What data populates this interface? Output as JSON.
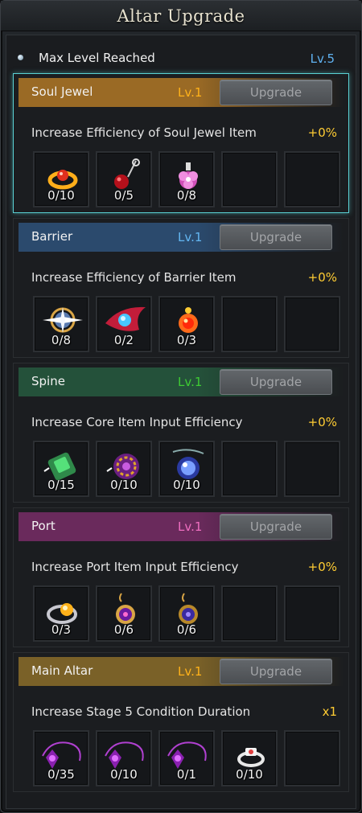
{
  "window": {
    "title": "Altar Upgrade"
  },
  "status": {
    "text": "Max Level Reached",
    "level": "Lv.5"
  },
  "colors": {
    "accent_blue": "#5fb1f0",
    "effect_yellow": "#ffcc33",
    "selected_border": "#5ad1d4"
  },
  "sections": [
    {
      "name": "Soul Jewel",
      "level": "Lv.1",
      "level_color": "#ffb21a",
      "header_color": "#9a6a25",
      "button": "Upgrade",
      "description": "Increase Efficiency of Soul Jewel Item",
      "value": "+0%",
      "items": [
        {
          "count": "0/10",
          "icon": "red-ring-icon"
        },
        {
          "count": "0/5",
          "icon": "red-bead-charm-icon"
        },
        {
          "count": "0/8",
          "icon": "pink-flower-icon"
        },
        {
          "count": "",
          "icon": ""
        },
        {
          "count": "",
          "icon": ""
        }
      ]
    },
    {
      "name": "Barrier",
      "level": "Lv.1",
      "level_color": "#63b6f2",
      "header_color": "#2b4a6d",
      "button": "Upgrade",
      "description": "Increase Efficiency of Barrier Item",
      "value": "+0%",
      "items": [
        {
          "count": "0/8",
          "icon": "silver-star-orb-icon"
        },
        {
          "count": "0/2",
          "icon": "red-blade-gem-icon"
        },
        {
          "count": "0/3",
          "icon": "fire-orb-icon"
        },
        {
          "count": "",
          "icon": ""
        },
        {
          "count": "",
          "icon": ""
        }
      ]
    },
    {
      "name": "Spine",
      "level": "Lv.1",
      "level_color": "#3ecb33",
      "header_color": "#24513a",
      "button": "Upgrade",
      "description": "Increase Core Item Input Efficiency",
      "value": "+0%",
      "items": [
        {
          "count": "0/15",
          "icon": "green-gem-gauntlet-icon"
        },
        {
          "count": "0/10",
          "icon": "purple-gold-rune-icon"
        },
        {
          "count": "0/10",
          "icon": "blue-orb-necklace-icon"
        },
        {
          "count": "",
          "icon": ""
        },
        {
          "count": "",
          "icon": ""
        }
      ]
    },
    {
      "name": "Port",
      "level": "Lv.1",
      "level_color": "#ef6ec0",
      "header_color": "#6a2a5c",
      "button": "Upgrade",
      "description": "Increase Port Item Input Efficiency",
      "value": "+0%",
      "items": [
        {
          "count": "0/3",
          "icon": "gold-ring-icon"
        },
        {
          "count": "0/6",
          "icon": "purple-earring-icon"
        },
        {
          "count": "0/6",
          "icon": "violet-earring-icon"
        },
        {
          "count": "",
          "icon": ""
        },
        {
          "count": "",
          "icon": ""
        }
      ]
    },
    {
      "name": "Main Altar",
      "level": "Lv.1",
      "level_color": "#ffb21a",
      "header_color": "#7a6128",
      "button": "Upgrade",
      "description": "Increase Stage 5 Condition Duration",
      "value": "x1",
      "items": [
        {
          "count": "0/35",
          "icon": "purple-demon-necklace-icon"
        },
        {
          "count": "0/10",
          "icon": "purple-demon-necklace-icon"
        },
        {
          "count": "0/1",
          "icon": "purple-demon-necklace-icon"
        },
        {
          "count": "0/10",
          "icon": "white-ring-icon"
        },
        {
          "count": "",
          "icon": ""
        }
      ]
    }
  ]
}
